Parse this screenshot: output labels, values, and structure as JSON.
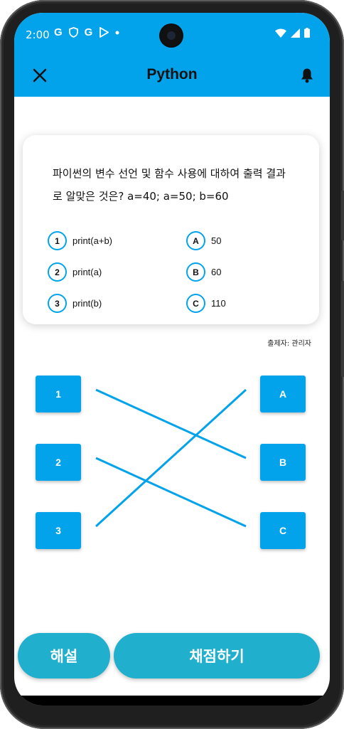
{
  "status": {
    "time": "2:00",
    "left_icons": [
      "G",
      "shield-icon",
      "G",
      "play-store-icon",
      "dot-icon"
    ],
    "right_icons": [
      "wifi-icon",
      "signal-icon",
      "battery-icon"
    ]
  },
  "appbar": {
    "title": "Python"
  },
  "question": {
    "text": "파이썬의 변수 선언 및 함수 사용에 대하여 출력 결과로 알맞은 것은?  a=40; a=50; b=60",
    "left_options": [
      {
        "key": "1",
        "label": "print(a+b)"
      },
      {
        "key": "2",
        "label": "print(a)"
      },
      {
        "key": "3",
        "label": "print(b)"
      }
    ],
    "right_options": [
      {
        "key": "A",
        "label": "50"
      },
      {
        "key": "B",
        "label": "60"
      },
      {
        "key": "C",
        "label": "110"
      }
    ]
  },
  "author": "출제자: 관리자",
  "match": {
    "left_nodes": [
      "1",
      "2",
      "3"
    ],
    "right_nodes": [
      "A",
      "B",
      "C"
    ],
    "connections": [
      [
        "1",
        "B"
      ],
      [
        "2",
        "C"
      ],
      [
        "3",
        "A"
      ]
    ],
    "line_color": "#03a3eb"
  },
  "buttons": {
    "explain": "해설",
    "grade": "채점하기"
  },
  "colors": {
    "primary": "#03a3eb",
    "button": "#20b0cd"
  }
}
